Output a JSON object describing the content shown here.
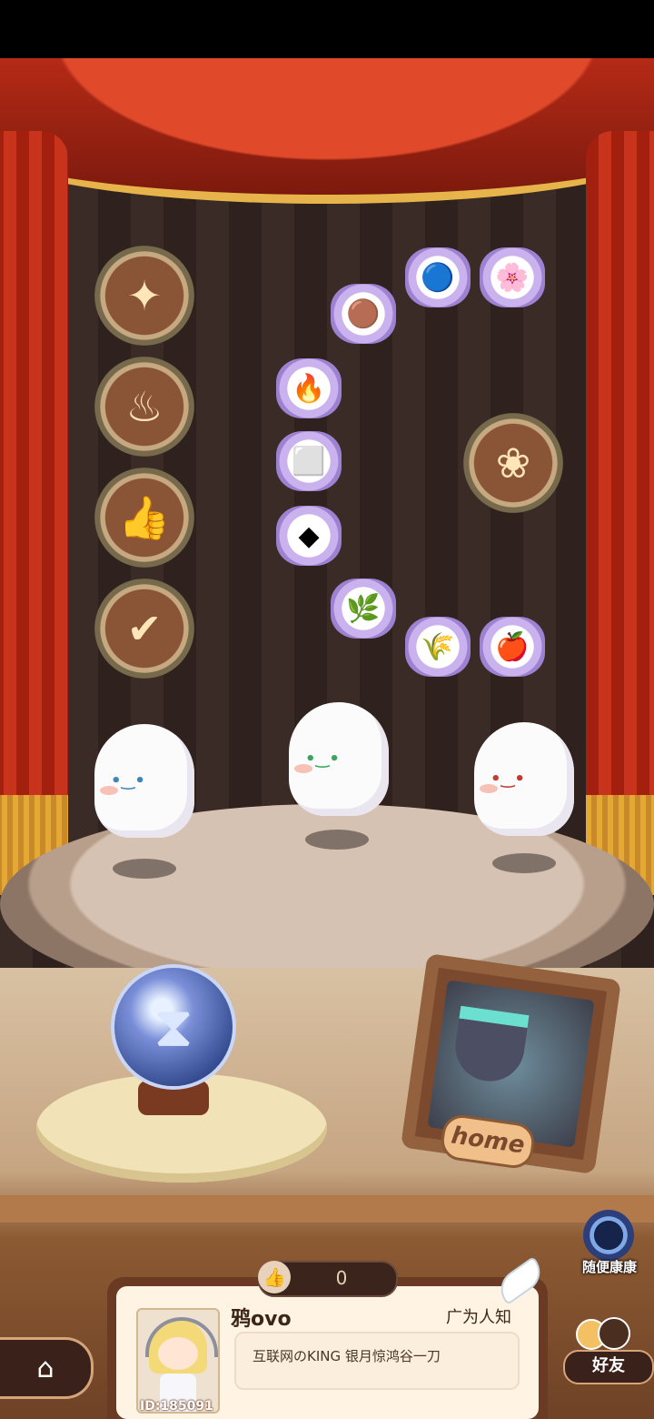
{
  "player": {
    "name": "鸦ovo",
    "id_label": "ID:185091",
    "fame_title": "广为人知",
    "signature": "互联网のKING  银月惊鸿谷一刀",
    "likes": "0"
  },
  "buttons": {
    "random_visit": "随便康康",
    "friends": "好友",
    "home_sign": "home"
  },
  "badges": [
    {
      "icon": "fairy-badge-icon",
      "glyph": "✦"
    },
    {
      "icon": "cauldron-badge-icon",
      "glyph": "♨"
    },
    {
      "icon": "thumbs-up-badge-icon",
      "glyph": "👍"
    },
    {
      "icon": "scroll-badge-icon",
      "glyph": "✔"
    },
    {
      "icon": "flower-badge-icon",
      "glyph": "❀"
    }
  ],
  "ingredients": [
    {
      "icon": "dirt-pile-icon",
      "glyph": "🟤"
    },
    {
      "icon": "mirror-icon",
      "glyph": "🔵"
    },
    {
      "icon": "purple-flower-icon",
      "glyph": "🌸"
    },
    {
      "icon": "coal-ore-icon",
      "glyph": "🔥"
    },
    {
      "icon": "white-crystal-icon",
      "glyph": "⬜"
    },
    {
      "icon": "dark-stone-icon",
      "glyph": "◆"
    },
    {
      "icon": "green-herb-icon",
      "glyph": "🌿"
    },
    {
      "icon": "wheat-icon",
      "glyph": "🌾"
    },
    {
      "icon": "red-fruit-icon",
      "glyph": "🍎"
    }
  ],
  "colors": {
    "curtain_red": "#b52a16",
    "gold_trim": "#e6b44a",
    "card_brown": "#6b3a22"
  }
}
